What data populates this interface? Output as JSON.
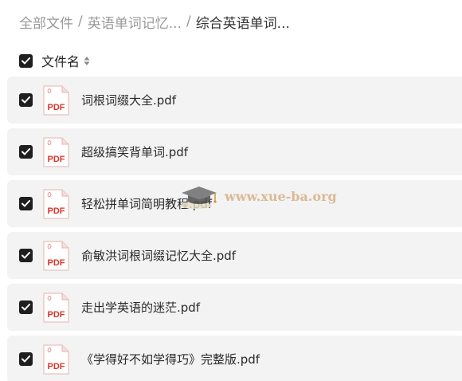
{
  "breadcrumb": {
    "items": [
      "全部文件",
      "英语单词记忆...",
      "综合英语单词..."
    ],
    "separator": "/"
  },
  "header": {
    "column_label": "文件名",
    "select_all_checked": true
  },
  "files": [
    {
      "name": "词根词缀大全.pdf",
      "type": "PDF",
      "checked": true
    },
    {
      "name": "超级搞笑背单词.pdf",
      "type": "PDF",
      "checked": true
    },
    {
      "name": "轻松拼单词简明教程.pdf",
      "type": "PDF",
      "checked": true
    },
    {
      "name": "俞敏洪词根词缀记忆大全.pdf",
      "type": "PDF",
      "checked": true
    },
    {
      "name": "走出学英语的迷茫.pdf",
      "type": "PDF",
      "checked": true
    },
    {
      "name": "《学得好不如学得巧》完整版.pdf",
      "type": "PDF",
      "checked": true
    }
  ],
  "watermark": {
    "text": "www.xue-ba.org"
  },
  "colors": {
    "checkbox": "#1f1f1f",
    "row_background": "#f3f3f3",
    "pdf_red": "#d9342b",
    "breadcrumb_muted": "#9a9a9a"
  },
  "icons": {
    "checkbox": "check-icon",
    "sort": "sort-icon",
    "file": "pdf-file-icon",
    "watermark": "graduation-cap-icon"
  }
}
